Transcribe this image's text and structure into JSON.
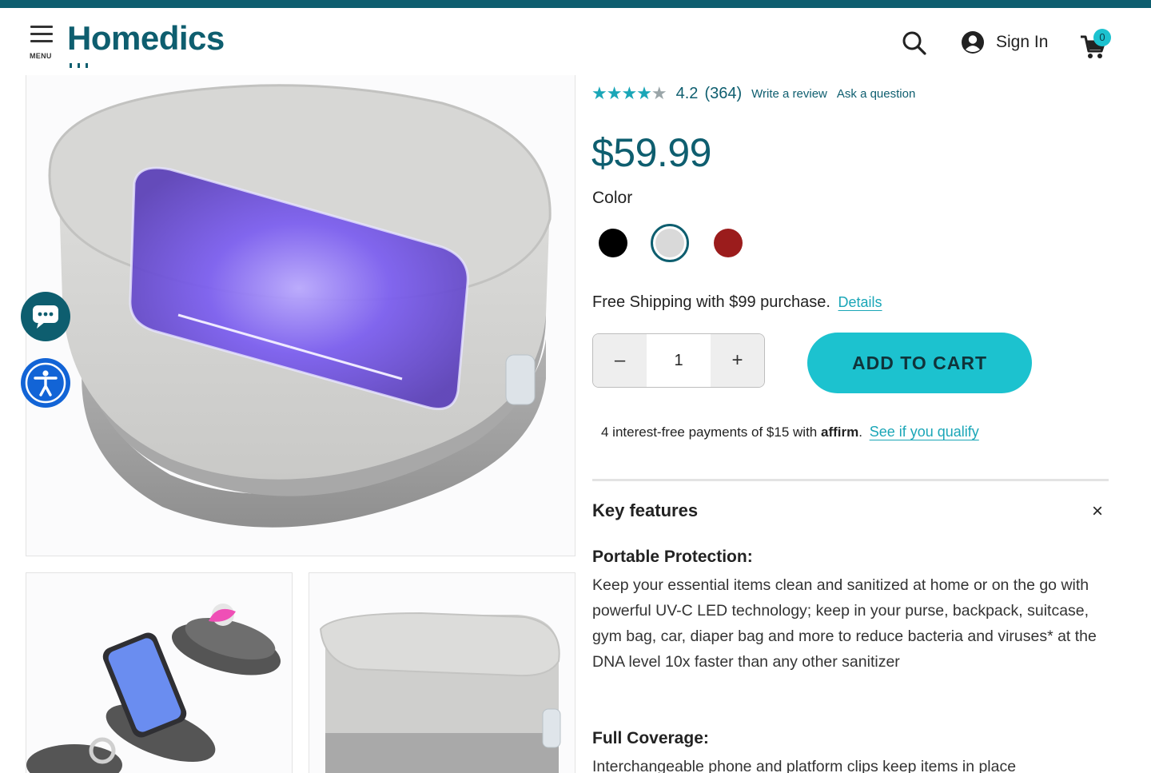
{
  "header": {
    "menu_label": "MENU",
    "logo_text": "Homedics",
    "signin_label": "Sign In",
    "cart_count": "0"
  },
  "rating": {
    "stars_value": 4.2,
    "score": "4.2",
    "count": "(364)",
    "write_review": "Write a review",
    "ask_question": "Ask a question"
  },
  "product": {
    "price": "$59.99",
    "color_label": "Color",
    "colors": [
      {
        "name": "black",
        "hex": "#000000",
        "selected": false
      },
      {
        "name": "grey",
        "hex": "#d9d9d9",
        "selected": true
      },
      {
        "name": "red",
        "hex": "#9b1c1c",
        "selected": false
      }
    ],
    "shipping_text": "Free Shipping with $99 purchase.",
    "shipping_details": "Details",
    "quantity": "1",
    "minus": "–",
    "plus": "+",
    "add_to_cart": "ADD TO CART",
    "affirm_text": "4 interest-free payments of $15 with",
    "affirm_brand": "affirm",
    "affirm_suffix": ".",
    "affirm_link": "See if you qualify"
  },
  "key_features": {
    "title": "Key features",
    "close": "×",
    "items": [
      {
        "heading": "Portable Protection:",
        "body": "Keep your essential items clean and sanitized at home or on the go with powerful UV-C LED technology; keep in your purse, backpack, suitcase, gym bag, car, diaper bag and more to reduce bacteria and viruses* at the DNA level 10x faster than any other sanitizer"
      },
      {
        "heading": "Full Coverage:",
        "body": "Interchangeable phone and platform clips keep items in place"
      }
    ]
  },
  "colors": {
    "brand_teal": "#0e5e6f",
    "accent_cyan": "#1cc2cf",
    "link_teal": "#1aa6b7",
    "a11y_blue": "#1264d6"
  },
  "icons": [
    "menu-icon",
    "search-icon",
    "user-icon",
    "cart-icon",
    "chat-icon",
    "accessibility-icon",
    "star-icon",
    "close-icon"
  ]
}
